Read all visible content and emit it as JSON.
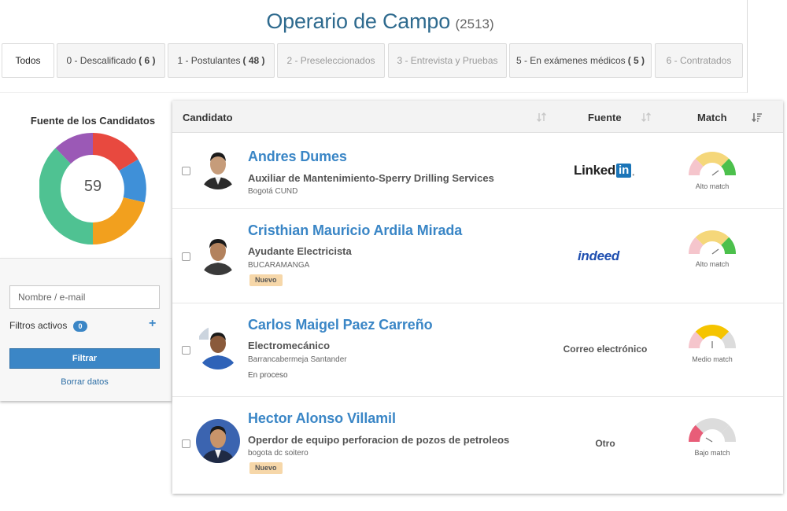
{
  "header": {
    "title": "Operario de Campo",
    "count": "(2513)"
  },
  "stages": [
    {
      "label": "Todos",
      "count": ""
    },
    {
      "label": "0 - Descalificado",
      "count": "( 6 )"
    },
    {
      "label": "1 - Postulantes",
      "count": "( 48 )"
    },
    {
      "label": "2 - Preseleccionados",
      "count": ""
    },
    {
      "label": "3 - Entrevista y Pruebas",
      "count": ""
    },
    {
      "label": "5 - En exámenes médicos",
      "count": "( 5 )"
    },
    {
      "label": "6 - Contratados",
      "count": ""
    }
  ],
  "sources_chart": {
    "title": "Fuente de los Candidatos",
    "total": "59",
    "colors": [
      "#e8493f",
      "#3f90d8",
      "#f2a01e",
      "#4fc292",
      "#9b59b6"
    ]
  },
  "filters": {
    "search_placeholder": "Nombre / e-mail",
    "active_label": "Filtros activos",
    "active_count": "0",
    "add_icon": "+",
    "filter_button": "Filtrar",
    "clear_link": "Borrar datos"
  },
  "table": {
    "col_candidate": "Candidato",
    "col_source": "Fuente",
    "col_match": "Match"
  },
  "candidates": [
    {
      "name": "Andres Dumes",
      "job": "Auxiliar de Mantenimiento-Sperry Drilling Services",
      "location": "Bogotá CUND",
      "badge": "",
      "status": "",
      "source": "LinkedIn",
      "match": "Alto match",
      "match_level": "high"
    },
    {
      "name": "Cristhian Mauricio Ardila Mirada",
      "job": "Ayudante Electricista",
      "location": "BUCARAMANGA",
      "badge": "Nuevo",
      "status": "",
      "source": "indeed",
      "match": "Alto match",
      "match_level": "high"
    },
    {
      "name": "Carlos Maigel Paez Carreño",
      "job": "Electromecánico",
      "location": "Barrancabermeja Santander",
      "badge": "",
      "status": "En proceso",
      "source": "Correo electrónico",
      "match": "Medio match",
      "match_level": "medium"
    },
    {
      "name": "Hector Alonso Villamil",
      "job": "Operdor de equipo perforacion de pozos de petroleos",
      "location": "bogota dc soitero",
      "badge": "Nuevo",
      "status": "",
      "source": "Otro",
      "match": "Bajo match",
      "match_level": "low"
    }
  ],
  "logos": {
    "linkedin_text": "Linked",
    "linkedin_box": "in",
    "indeed_text": "indeed"
  }
}
